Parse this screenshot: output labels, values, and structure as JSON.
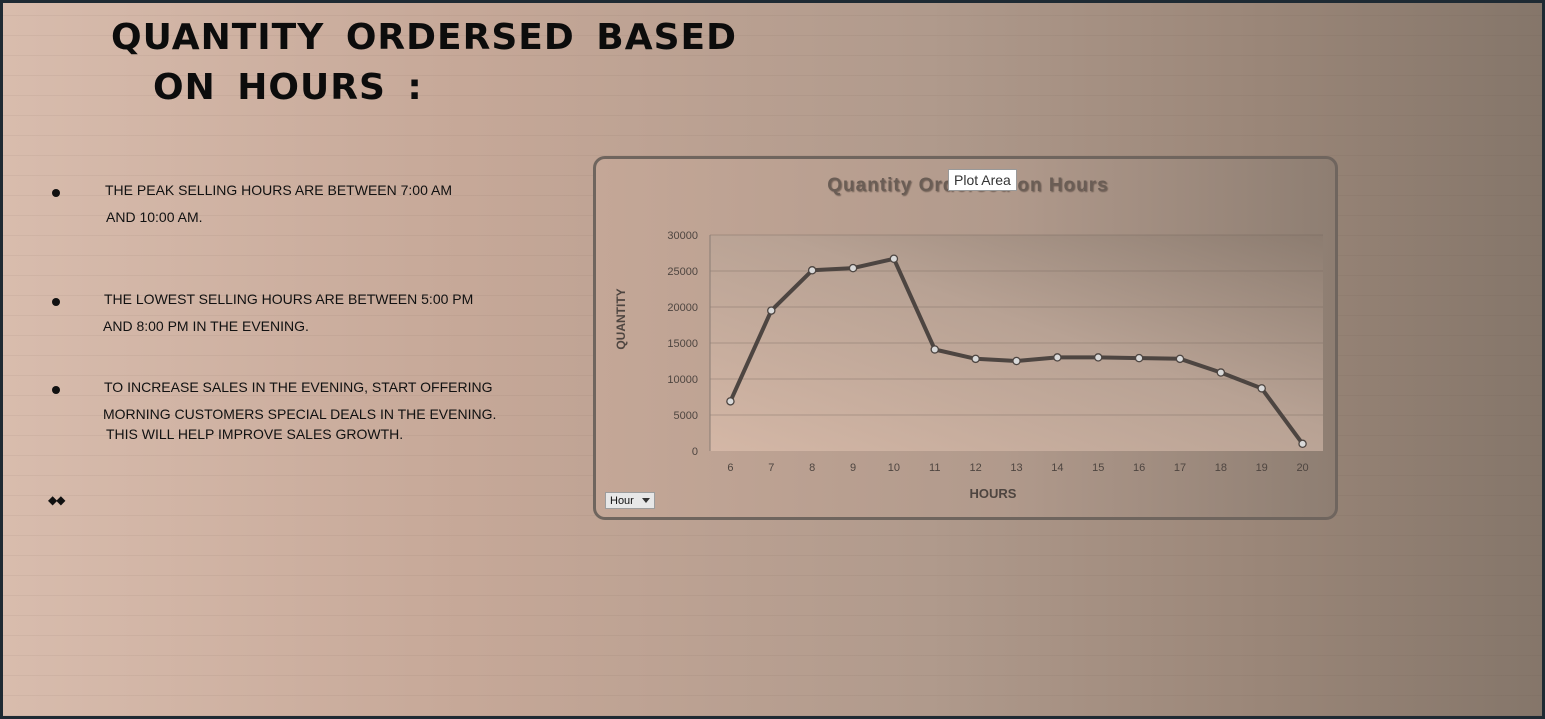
{
  "heading": {
    "line1": "QUANTITY ORDERSED BASED",
    "line2": "ON HOURS :"
  },
  "bullets": [
    {
      "lines": [
        "THE PEAK SELLING HOURS ARE BETWEEN 7:00 AM",
        "AND 10:00 AM."
      ]
    },
    {
      "lines": [
        "THE LOWEST SELLING HOURS ARE BETWEEN 5:00 PM",
        "AND 8:00 PM IN THE EVENING."
      ]
    },
    {
      "lines": [
        "TO INCREASE SALES IN THE EVENING, START OFFERING",
        "MORNING CUSTOMERS SPECIAL DEALS IN THE EVENING.",
        "THIS WILL HELP IMPROVE SALES GROWTH."
      ]
    }
  ],
  "diamonds": "◆◆",
  "tooltip": "Plot Area",
  "field_button": {
    "label": "Hour"
  },
  "chart_data": {
    "type": "line",
    "title": "Quantity Ordersed on Hours",
    "xlabel": "HOURS",
    "ylabel": "QUANTITY",
    "categories": [
      "6",
      "7",
      "8",
      "9",
      "10",
      "11",
      "12",
      "13",
      "14",
      "15",
      "16",
      "17",
      "18",
      "19",
      "20"
    ],
    "values": [
      6900,
      19500,
      25100,
      25400,
      26700,
      14100,
      12800,
      12500,
      13000,
      13000,
      12900,
      12800,
      10900,
      8700,
      1000
    ],
    "ylim": [
      0,
      30000
    ],
    "yticks": [
      "0",
      "5000",
      "10000",
      "15000",
      "20000",
      "25000",
      "30000"
    ],
    "grid": true,
    "colors": {
      "line": "#4d4541",
      "marker_fill": "#d9d9d9",
      "title": "#6b5d55"
    }
  }
}
